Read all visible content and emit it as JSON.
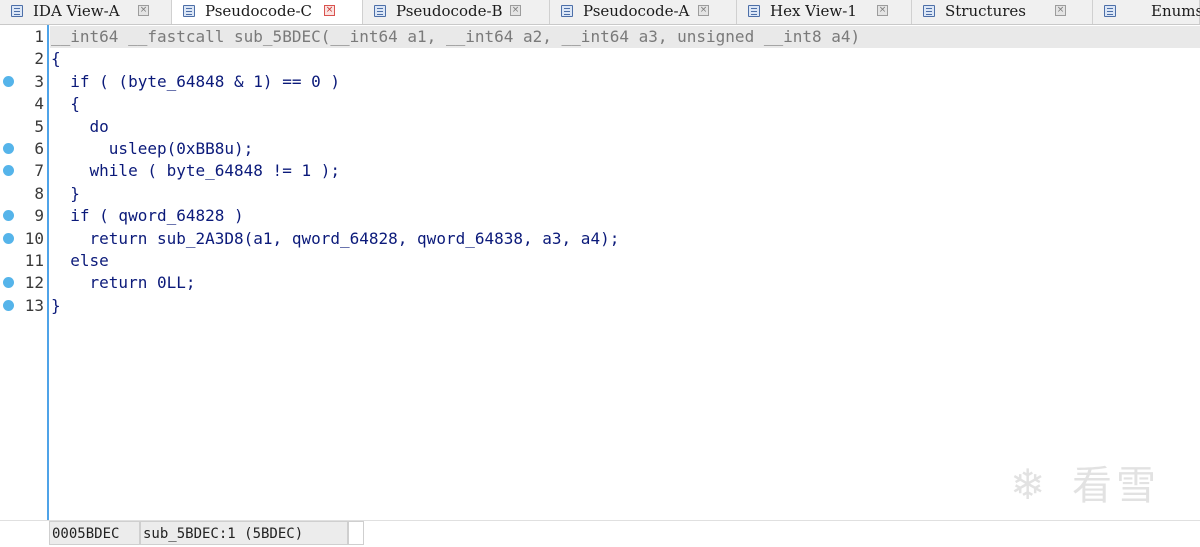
{
  "tabs": [
    {
      "label": "IDA View-A",
      "active": false
    },
    {
      "label": "Pseudocode-C",
      "active": true
    },
    {
      "label": "Pseudocode-B",
      "active": false
    },
    {
      "label": "Pseudocode-A",
      "active": false
    },
    {
      "label": "Hex View-1",
      "active": false
    },
    {
      "label": "Structures",
      "active": false
    },
    {
      "label": "Enums",
      "active": false
    }
  ],
  "tab_close_glyph": "×",
  "code_lines": [
    {
      "num": "1",
      "text": "__int64 __fastcall sub_5BDEC(__int64 a1, __int64 a2, __int64 a3, unsigned __int8 a4)",
      "breakpoint": false
    },
    {
      "num": "2",
      "text": "{",
      "breakpoint": false
    },
    {
      "num": "3",
      "text": "  if ( (byte_64848 & 1) == 0 )",
      "breakpoint": true
    },
    {
      "num": "4",
      "text": "  {",
      "breakpoint": false
    },
    {
      "num": "5",
      "text": "    do",
      "breakpoint": false
    },
    {
      "num": "6",
      "text": "      usleep(0xBB8u);",
      "breakpoint": true
    },
    {
      "num": "7",
      "text": "    while ( byte_64848 != 1 );",
      "breakpoint": true
    },
    {
      "num": "8",
      "text": "  }",
      "breakpoint": false
    },
    {
      "num": "9",
      "text": "  if ( qword_64828 )",
      "breakpoint": true
    },
    {
      "num": "10",
      "text": "    return sub_2A3D8(a1, qword_64828, qword_64838, a3, a4);",
      "breakpoint": true
    },
    {
      "num": "11",
      "text": "  else",
      "breakpoint": false
    },
    {
      "num": "12",
      "text": "    return 0LL;",
      "breakpoint": true
    },
    {
      "num": "13",
      "text": "}",
      "breakpoint": true
    }
  ],
  "status": {
    "address": "0005BDEC",
    "location": "sub_5BDEC:1 (5BDEC)"
  },
  "watermark": {
    "glyph": "❄",
    "text": "看雪"
  },
  "colors": {
    "code_text": "#0b1a7a",
    "breakpoint": "#55b4ea",
    "gutter_border": "#4fa3e8",
    "current_line_bg": "#e9e9e9"
  }
}
